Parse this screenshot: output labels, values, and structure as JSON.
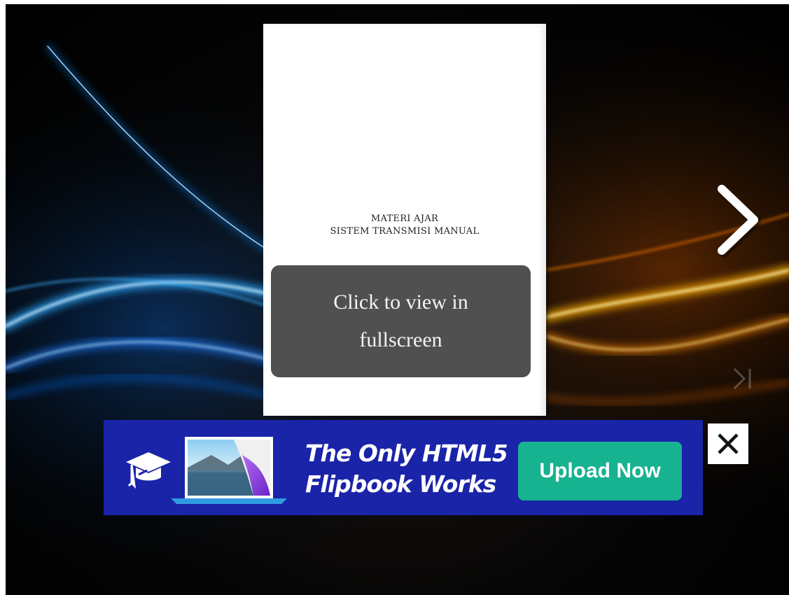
{
  "document": {
    "title_line1": "MATERI AJAR",
    "title_line2": "SISTEM TRANSMISI MANUAL"
  },
  "fullscreen_prompt": {
    "line1": "Click to view in",
    "line2": "fullscreen"
  },
  "navigation": {
    "next_icon": "chevron-right-icon",
    "last_icon": "skip-to-end-icon"
  },
  "ad": {
    "headline_line1": "The Only HTML5",
    "headline_line2": "Flipbook Works",
    "button_label": "Upload Now",
    "close_icon": "close-icon",
    "colors": {
      "banner_bg": "#1a24a8",
      "button_bg": "#17b28f"
    }
  }
}
